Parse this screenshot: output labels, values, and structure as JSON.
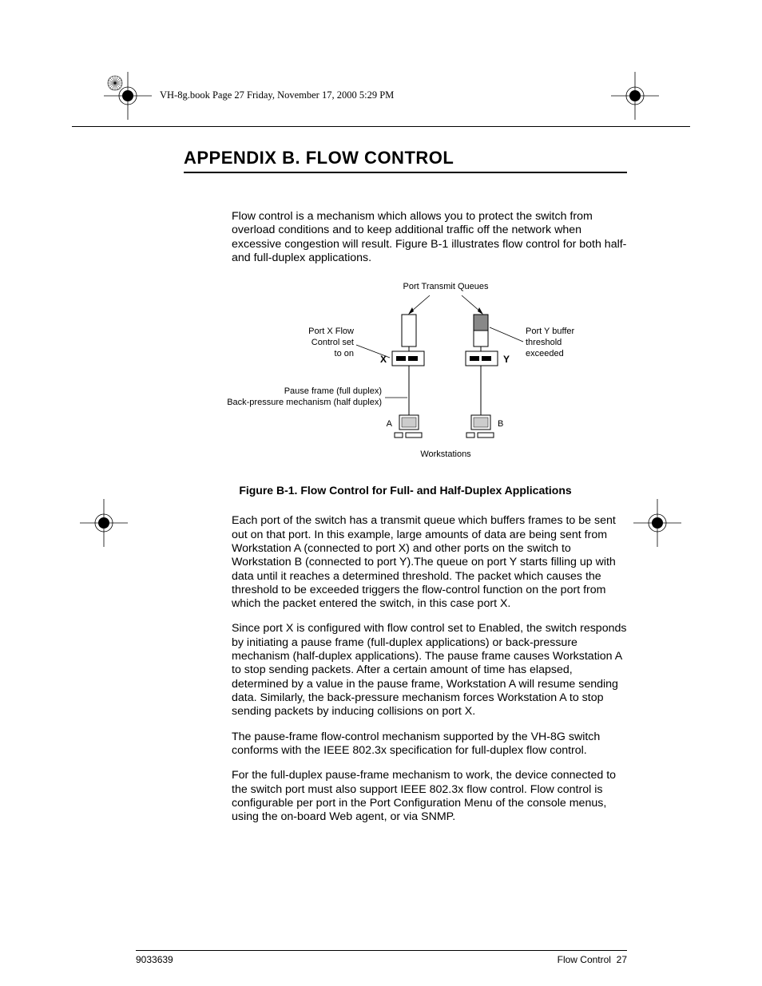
{
  "header_note": "VH-8g.book  Page 27  Friday, November 17, 2000  5:29 PM",
  "title": "APPENDIX B.  FLOW CONTROL",
  "paragraphs": {
    "p1": "Flow control is a mechanism which allows you to protect the switch from overload conditions and to keep additional traffic off the network when excessive congestion will result. Figure B-1 illustrates flow control for both half- and full-duplex applications.",
    "p2": "Each port of the switch has a transmit queue which buffers frames to be sent out on that port. In this example, large amounts of data are being sent from Workstation A (connected to port X) and other ports on the switch to Workstation B (connected to port Y).The queue on port Y starts filling up with data until it reaches a determined threshold. The packet which causes the threshold to be exceeded triggers the flow-control function on the port from which the packet entered the switch, in this case port X.",
    "p3": "Since port X is configured with flow control set to Enabled, the switch responds by initiating a pause frame (full-duplex applications) or back-pressure mechanism (half-duplex applications). The pause frame causes Workstation A to stop sending packets. After a certain amount of time has elapsed, determined by a value in the pause frame, Workstation A will resume sending data. Similarly, the back-pressure mechanism forces Workstation A to stop sending packets by inducing collisions on port X.",
    "p4": "The pause-frame flow-control mechanism supported by the VH-8G switch conforms with the IEEE 802.3x specification for full-duplex flow control.",
    "p5": "For the full-duplex pause-frame mechanism to work, the device connected to the switch port must also support IEEE 802.3x flow control. Flow control is configurable per port in the Port Configuration Menu of the console menus, using the on-board Web agent, or via SNMP."
  },
  "figure": {
    "caption": "Figure B-1. Flow Control for Full- and Half-Duplex Applications",
    "labels": {
      "top": "Port Transmit Queues",
      "left1": "Port X Flow",
      "left2": "Control set",
      "left3": "to on",
      "right1": "Port Y buffer",
      "right2": "threshold",
      "right3": "exceeded",
      "pause1": "Pause frame (full duplex)",
      "pause2": "Back-pressure mechanism (half duplex)",
      "A": "A",
      "B": "B",
      "X": "X",
      "Y": "Y",
      "work": "Workstations"
    }
  },
  "footer": {
    "left": "9033639",
    "right_label": "Flow Control",
    "right_page": "27"
  },
  "chart_data": {
    "type": "diagram",
    "description": "Flow control diagram for a switch",
    "nodes": [
      {
        "id": "queue_x",
        "label": "Port X transmit queue"
      },
      {
        "id": "queue_y",
        "label": "Port Y transmit queue"
      },
      {
        "id": "port_x",
        "label": "X",
        "note": "Port X Flow Control set to on"
      },
      {
        "id": "port_y",
        "label": "Y",
        "note": "Port Y buffer threshold exceeded"
      },
      {
        "id": "ws_a",
        "label": "A",
        "type": "Workstation"
      },
      {
        "id": "ws_b",
        "label": "B",
        "type": "Workstation"
      }
    ],
    "edges": [
      {
        "from": "queue_x",
        "to": "port_x"
      },
      {
        "from": "queue_y",
        "to": "port_y"
      },
      {
        "from": "port_x",
        "to": "ws_a",
        "label": "Pause frame (full duplex) / Back-pressure mechanism (half duplex)"
      },
      {
        "from": "port_y",
        "to": "ws_b"
      }
    ],
    "top_label": "Port Transmit Queues",
    "bottom_label": "Workstations"
  }
}
